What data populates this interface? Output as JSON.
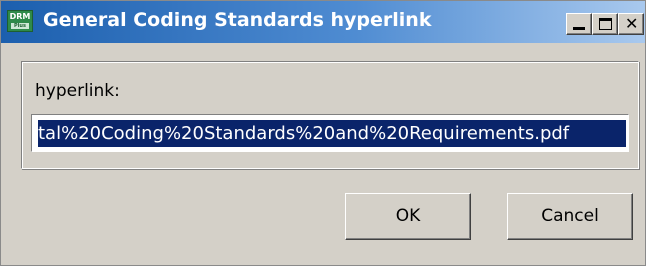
{
  "window": {
    "title": "General Coding Standards hyperlink",
    "icon": "drm-app-icon",
    "icon_text": "DRM",
    "icon_subtext": "Plus",
    "controls": {
      "minimize": "minimize-icon",
      "maximize": "maximize-icon",
      "close": "close-icon",
      "close_glyph": "✕"
    }
  },
  "form": {
    "label": "hyperlink:",
    "value": "tal%20Coding%20Standards%20and%20Requirements.pdf"
  },
  "buttons": {
    "ok": "OK",
    "cancel": "Cancel"
  },
  "colors": {
    "titlebar_start": "#1c5fae",
    "titlebar_end": "#a9c9ee",
    "selection": "#0a246a",
    "dialog_bg": "#d4d0c8"
  }
}
